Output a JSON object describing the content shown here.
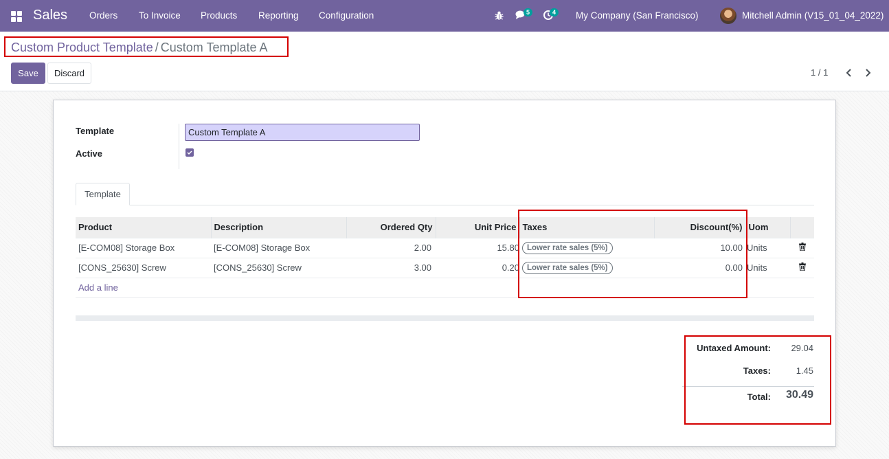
{
  "navbar": {
    "app_name": "Sales",
    "menu": [
      "Orders",
      "To Invoice",
      "Products",
      "Reporting",
      "Configuration"
    ],
    "messages_badge": "5",
    "activities_badge": "4",
    "company": "My Company (San Francisco)",
    "user": "Mitchell Admin (V15_01_04_2022)",
    "color": "#71639e"
  },
  "breadcrumb": {
    "parent": "Custom Product Template",
    "separator": "/",
    "current": "Custom Template A"
  },
  "buttons": {
    "save": "Save",
    "discard": "Discard"
  },
  "pager": {
    "value": "1 / 1"
  },
  "form": {
    "template_label": "Template",
    "template_value": "Custom Template A",
    "active_label": "Active",
    "active_checked": true
  },
  "tabs": [
    "Template"
  ],
  "lines_table": {
    "headers": [
      "Product",
      "Description",
      "Ordered Qty",
      "Unit Price",
      "Taxes",
      "Discount(%)",
      "Uom"
    ],
    "rows": [
      {
        "product": "[E-COM08] Storage Box",
        "description": "[E-COM08] Storage Box",
        "qty": "2.00",
        "price": "15.80",
        "tax": "Lower rate sales (5%)",
        "discount": "10.00",
        "uom": "Units"
      },
      {
        "product": "[CONS_25630] Screw",
        "description": "[CONS_25630] Screw",
        "qty": "3.00",
        "price": "0.20",
        "tax": "Lower rate sales (5%)",
        "discount": "0.00",
        "uom": "Units"
      }
    ],
    "add_line": "Add a line"
  },
  "totals": {
    "untaxed_label": "Untaxed Amount:",
    "untaxed_value": "29.04",
    "taxes_label": "Taxes:",
    "taxes_value": "1.45",
    "total_label": "Total:",
    "total_value": "30.49"
  }
}
